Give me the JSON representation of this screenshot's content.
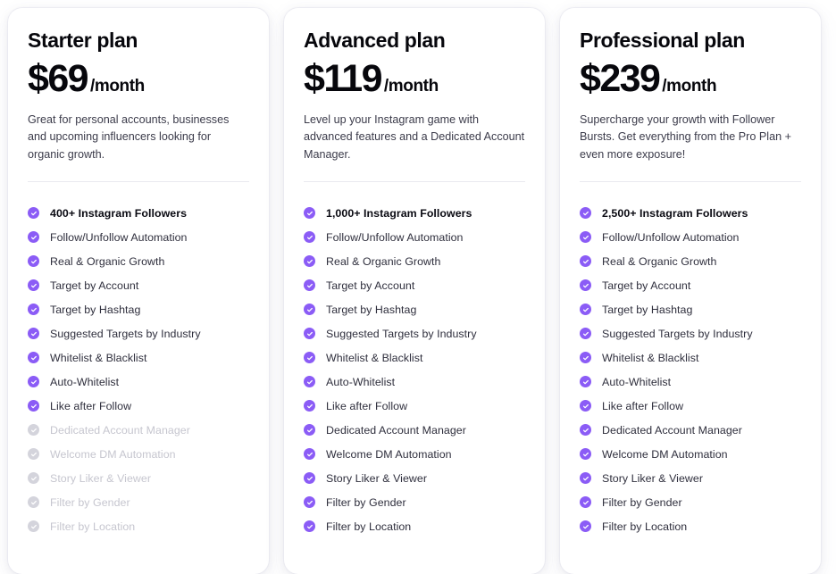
{
  "page": {
    "background_color": "#ffffff",
    "accent_color": "#8b5cf6",
    "disabled_color": "#d4d4dc",
    "text_color": "#2f2f3d"
  },
  "plans": [
    {
      "title": "Starter plan",
      "price": "$69",
      "period": "/month",
      "description": "Great for personal accounts, businesses and upcoming influencers looking for organic growth.",
      "features": [
        {
          "label": "400+ Instagram Followers",
          "included": true,
          "highlight": true
        },
        {
          "label": "Follow/Unfollow Automation",
          "included": true,
          "highlight": false
        },
        {
          "label": "Real & Organic Growth",
          "included": true,
          "highlight": false
        },
        {
          "label": "Target by Account",
          "included": true,
          "highlight": false
        },
        {
          "label": "Target by Hashtag",
          "included": true,
          "highlight": false
        },
        {
          "label": "Suggested Targets by Industry",
          "included": true,
          "highlight": false
        },
        {
          "label": "Whitelist & Blacklist",
          "included": true,
          "highlight": false
        },
        {
          "label": "Auto-Whitelist",
          "included": true,
          "highlight": false
        },
        {
          "label": "Like after Follow",
          "included": true,
          "highlight": false
        },
        {
          "label": "Dedicated Account Manager",
          "included": false,
          "highlight": false
        },
        {
          "label": "Welcome DM Automation",
          "included": false,
          "highlight": false
        },
        {
          "label": "Story Liker & Viewer",
          "included": false,
          "highlight": false
        },
        {
          "label": "Filter by Gender",
          "included": false,
          "highlight": false
        },
        {
          "label": "Filter by Location",
          "included": false,
          "highlight": false
        }
      ]
    },
    {
      "title": "Advanced plan",
      "price": "$119",
      "period": "/month",
      "description": "Level up your Instagram game with advanced features and a Dedicated Account Manager.",
      "features": [
        {
          "label": "1,000+ Instagram Followers",
          "included": true,
          "highlight": true
        },
        {
          "label": "Follow/Unfollow Automation",
          "included": true,
          "highlight": false
        },
        {
          "label": "Real & Organic Growth",
          "included": true,
          "highlight": false
        },
        {
          "label": "Target by Account",
          "included": true,
          "highlight": false
        },
        {
          "label": "Target by Hashtag",
          "included": true,
          "highlight": false
        },
        {
          "label": "Suggested Targets by Industry",
          "included": true,
          "highlight": false
        },
        {
          "label": "Whitelist & Blacklist",
          "included": true,
          "highlight": false
        },
        {
          "label": "Auto-Whitelist",
          "included": true,
          "highlight": false
        },
        {
          "label": "Like after Follow",
          "included": true,
          "highlight": false
        },
        {
          "label": "Dedicated Account Manager",
          "included": true,
          "highlight": false
        },
        {
          "label": "Welcome DM Automation",
          "included": true,
          "highlight": false
        },
        {
          "label": "Story Liker & Viewer",
          "included": true,
          "highlight": false
        },
        {
          "label": "Filter by Gender",
          "included": true,
          "highlight": false
        },
        {
          "label": "Filter by Location",
          "included": true,
          "highlight": false
        }
      ]
    },
    {
      "title": "Professional plan",
      "price": "$239",
      "period": "/month",
      "description": "Supercharge your growth with Follower Bursts. Get everything from the Pro Plan + even more exposure!",
      "features": [
        {
          "label": "2,500+ Instagram Followers",
          "included": true,
          "highlight": true
        },
        {
          "label": "Follow/Unfollow Automation",
          "included": true,
          "highlight": false
        },
        {
          "label": "Real & Organic Growth",
          "included": true,
          "highlight": false
        },
        {
          "label": "Target by Account",
          "included": true,
          "highlight": false
        },
        {
          "label": "Target by Hashtag",
          "included": true,
          "highlight": false
        },
        {
          "label": "Suggested Targets by Industry",
          "included": true,
          "highlight": false
        },
        {
          "label": "Whitelist & Blacklist",
          "included": true,
          "highlight": false
        },
        {
          "label": "Auto-Whitelist",
          "included": true,
          "highlight": false
        },
        {
          "label": "Like after Follow",
          "included": true,
          "highlight": false
        },
        {
          "label": "Dedicated Account Manager",
          "included": true,
          "highlight": false
        },
        {
          "label": "Welcome DM Automation",
          "included": true,
          "highlight": false
        },
        {
          "label": "Story Liker & Viewer",
          "included": true,
          "highlight": false
        },
        {
          "label": "Filter by Gender",
          "included": true,
          "highlight": false
        },
        {
          "label": "Filter by Location",
          "included": true,
          "highlight": false
        }
      ]
    }
  ],
  "icons": {
    "check": "check-circle-icon"
  }
}
